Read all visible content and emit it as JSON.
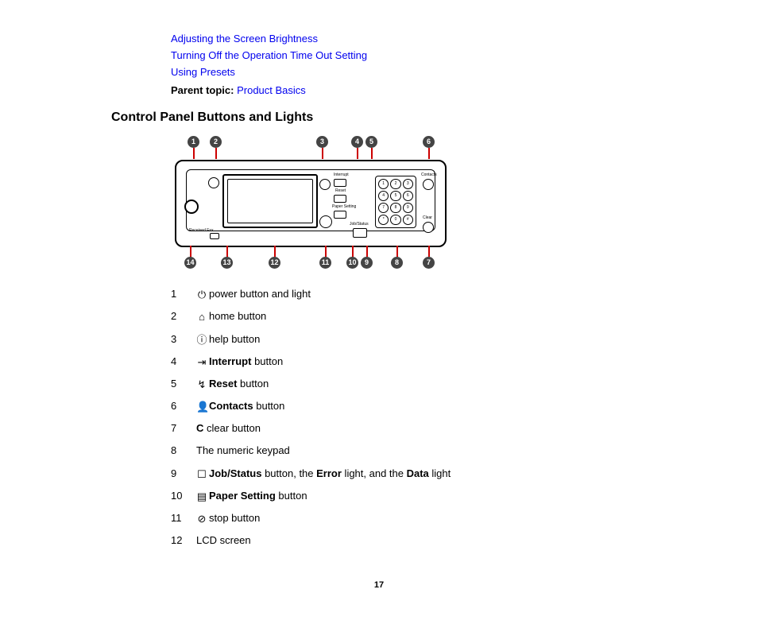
{
  "top_links": [
    "Adjusting the Screen Brightness",
    "Turning Off the Operation Time Out Setting",
    "Using Presets"
  ],
  "parent_topic": {
    "label": "Parent topic:",
    "link": "Product Basics"
  },
  "section_title": "Control Panel Buttons and Lights",
  "callouts_top": [
    {
      "n": "1"
    },
    {
      "n": "2"
    },
    {
      "n": "3"
    },
    {
      "n": "4"
    },
    {
      "n": "5"
    },
    {
      "n": "6"
    }
  ],
  "callouts_bottom": [
    {
      "n": "14"
    },
    {
      "n": "13"
    },
    {
      "n": "12"
    },
    {
      "n": "11"
    },
    {
      "n": "10"
    },
    {
      "n": "9"
    },
    {
      "n": "8"
    },
    {
      "n": "7"
    }
  ],
  "panel_labels": {
    "interrupt": "Interrupt",
    "reset": "Reset",
    "paper": "Paper Setting",
    "job": "Job/Status",
    "contacts": "Contacts",
    "clear": "Clear",
    "received": "Received Fax"
  },
  "keypad": [
    "1",
    "2",
    "3",
    "4",
    "5",
    "6",
    "7",
    "8",
    "9",
    "*",
    "0",
    "#"
  ],
  "legend": [
    {
      "num": "1",
      "icon": "⏻",
      "before": "",
      "bold": "",
      "after": "power button and light"
    },
    {
      "num": "2",
      "icon": "⌂",
      "before": "",
      "bold": "",
      "after": "home button"
    },
    {
      "num": "3",
      "icon": "ⓘ",
      "before": "",
      "bold": "",
      "after": "help button"
    },
    {
      "num": "4",
      "icon": "⇥",
      "before": "",
      "bold": "Interrupt",
      "after": " button"
    },
    {
      "num": "5",
      "icon": "↯",
      "before": "",
      "bold": "Reset",
      "after": " button"
    },
    {
      "num": "6",
      "icon": "👤",
      "before": "",
      "bold": "Contacts",
      "after": " button"
    },
    {
      "num": "7",
      "icon": "",
      "before": "",
      "bold": "C",
      "after": " clear button"
    },
    {
      "num": "8",
      "icon": "",
      "before": "The numeric keypad",
      "bold": "",
      "after": ""
    },
    {
      "num": "9",
      "icon": "☐",
      "before": "",
      "bold": "Job/Status",
      "after_bold_extra": " button, the ",
      "bold2": "Error",
      "mid2": " light, and the ",
      "bold3": "Data",
      "after": " light"
    },
    {
      "num": "10",
      "icon": "▤",
      "before": "",
      "bold": "Paper Setting",
      "after": " button"
    },
    {
      "num": "11",
      "icon": "⊘",
      "before": "",
      "bold": "",
      "after": "stop button"
    },
    {
      "num": "12",
      "icon": "",
      "before": "LCD screen",
      "bold": "",
      "after": ""
    }
  ],
  "page_number": "17"
}
